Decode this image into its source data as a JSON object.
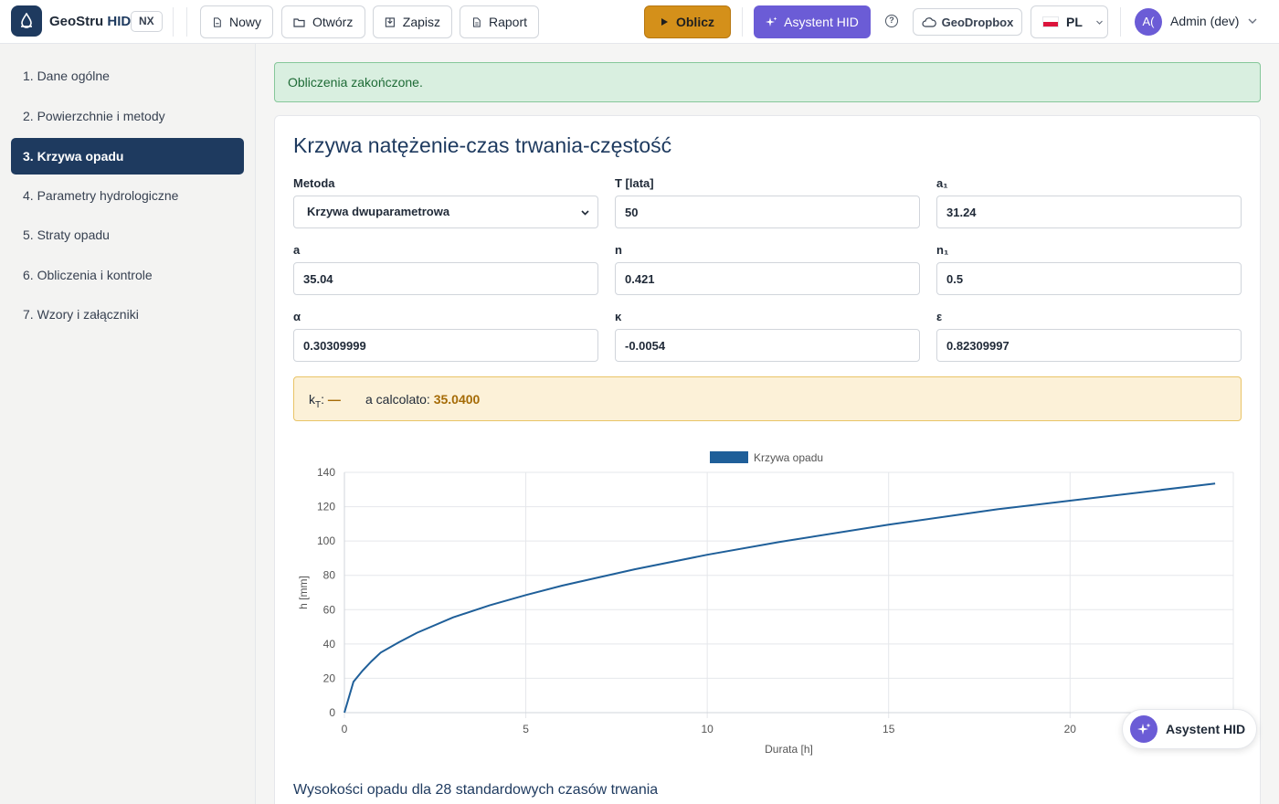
{
  "header": {
    "brand_prefix": "GeoStru",
    "brand_suffix": "HID",
    "edition": "NX",
    "buttons": {
      "new": "Nowy",
      "open": "Otwórz",
      "save": "Zapisz",
      "report": "Raport"
    },
    "calculate": "Oblicz",
    "assistant": "Asystent HID",
    "help": "?",
    "dropbox": "GeoDropbox",
    "language": "PL",
    "user_initials": "A(",
    "user_name": "Admin (dev)"
  },
  "sidebar": {
    "items": [
      {
        "label": "1. Dane ogólne"
      },
      {
        "label": "2. Powierzchnie i metody"
      },
      {
        "label": "3. Krzywa opadu",
        "active": true
      },
      {
        "label": "4. Parametry hydrologiczne"
      },
      {
        "label": "5. Straty opadu"
      },
      {
        "label": "6. Obliczenia i kontrole"
      },
      {
        "label": "7. Wzory i załączniki"
      }
    ]
  },
  "alert": {
    "text": "Obliczenia zakończone."
  },
  "card": {
    "title": "Krzywa natężenie-czas trwania-częstość",
    "fields": {
      "metoda": {
        "label": "Metoda",
        "value": "Krzywa dwuparametrowa"
      },
      "T": {
        "label": "T [lata]",
        "value": "50"
      },
      "a1": {
        "label": "a₁",
        "value": "31.24"
      },
      "a": {
        "label": "a",
        "value": "35.04"
      },
      "n": {
        "label": "n",
        "value": "0.421"
      },
      "n1": {
        "label": "n₁",
        "value": "0.5"
      },
      "alpha": {
        "label": "α",
        "value": "0.30309999"
      },
      "kappa": {
        "label": "κ",
        "value": "-0.0054"
      },
      "epsilon": {
        "label": "ε",
        "value": "0.82309997"
      }
    },
    "kt": {
      "label_k": "k",
      "label_sub": "T",
      "label_colon": ":",
      "value": "—",
      "acalc_label": "a calcolato: ",
      "acalc_value": "35.0400"
    },
    "table_title": "Wysokości opadu dla 28 standardowych czasów trwania"
  },
  "chart_data": {
    "type": "line",
    "legend": "Krzywa opadu",
    "legend_position": "top-center",
    "xlabel": "Durata [h]",
    "ylabel": "h [mm]",
    "xlim": [
      0,
      24.5
    ],
    "ylim": [
      0,
      140
    ],
    "xticks": [
      "0",
      "5",
      "10",
      "15",
      "20"
    ],
    "yticks": [
      "0",
      "20",
      "40",
      "60",
      "80",
      "100",
      "120",
      "140"
    ],
    "grid": true,
    "series": [
      {
        "name": "Krzywa opadu",
        "color": "#1f5f99",
        "x": [
          0,
          0.25,
          0.5,
          0.75,
          1,
          1.5,
          2,
          3,
          4,
          5,
          6,
          8,
          10,
          12,
          15,
          18,
          20,
          24
        ],
        "y": [
          0,
          18,
          24.5,
          30,
          35,
          41,
          46.5,
          55.5,
          62.5,
          68.5,
          74,
          83.5,
          92,
          99.5,
          109.5,
          118.5,
          123.5,
          133.5
        ]
      }
    ]
  },
  "fab": {
    "label": "Asystent HID"
  }
}
